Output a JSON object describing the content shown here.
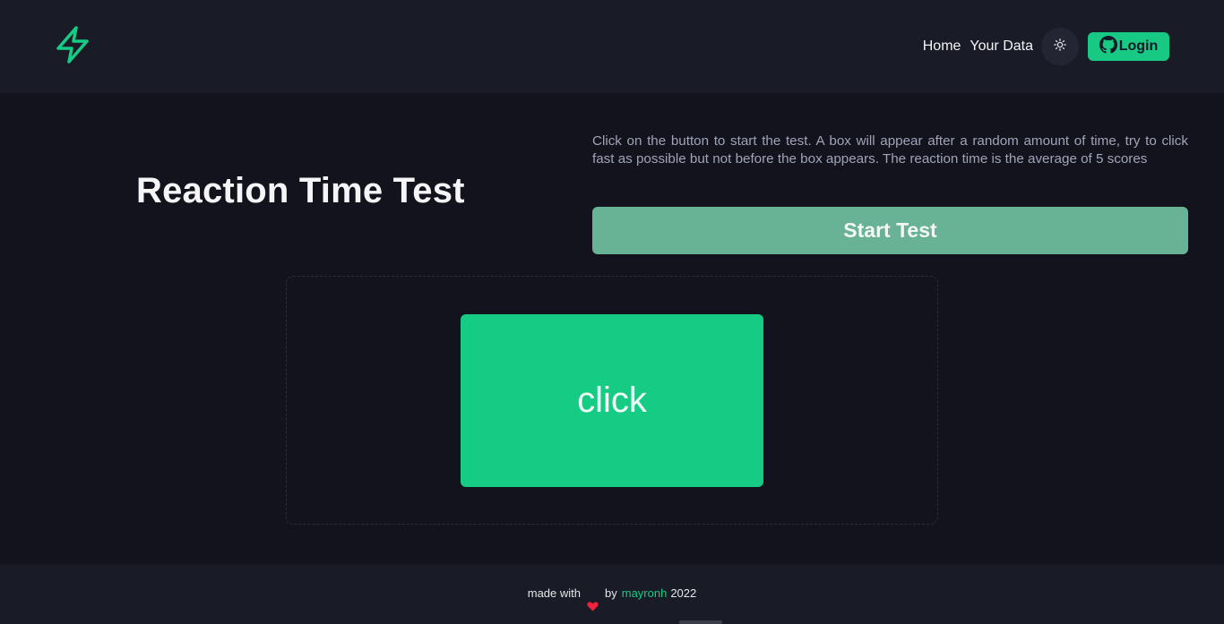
{
  "header": {
    "logo_icon": "lightning-bolt-icon",
    "nav": [
      {
        "label": "Home"
      },
      {
        "label": "Your Data"
      }
    ],
    "theme_icon": "sun-icon",
    "login": {
      "label": "Login",
      "icon": "github-icon"
    }
  },
  "main": {
    "title": "Reaction Time Test",
    "description": "Click on the button to start the test. A box will appear after a random amount of time, try to click fast as possible but not before the box appears. The reaction time is the average of 5 scores",
    "start_button": "Start Test",
    "click_box": "click"
  },
  "footer": {
    "made_with": "made with",
    "heart_icon": "heart-icon",
    "by": "by",
    "author": "mayronh",
    "year": "2022"
  },
  "colors": {
    "accent": "#16cb84",
    "background": "#12131d",
    "navbar": "#191b26",
    "start_button": "#68b296"
  }
}
